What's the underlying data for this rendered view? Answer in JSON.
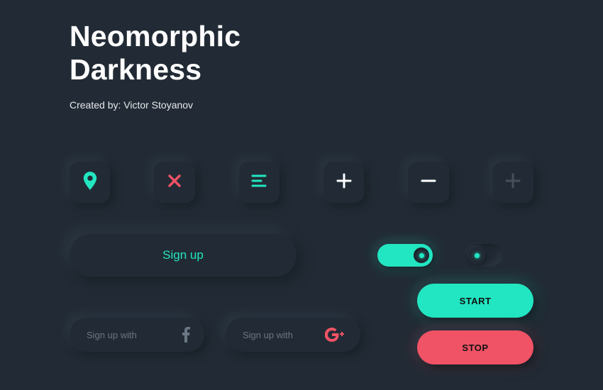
{
  "header": {
    "title_line1": "Neomorphic",
    "title_line2": "Darkness",
    "byline": "Created by: Victor Stoyanov"
  },
  "colors": {
    "accent": "#21e6c1",
    "danger": "#f05365",
    "bg": "#222b35",
    "muted": "#6a7683"
  },
  "icon_buttons": [
    {
      "name": "location-pin-icon"
    },
    {
      "name": "close-icon"
    },
    {
      "name": "menu-icon"
    },
    {
      "name": "plus-icon"
    },
    {
      "name": "minus-icon"
    },
    {
      "name": "plus-muted-icon"
    }
  ],
  "signup": {
    "label": "Sign up"
  },
  "toggles": {
    "on": true,
    "off": false
  },
  "social": [
    {
      "label": "Sign up with",
      "provider": "facebook"
    },
    {
      "label": "Sign up with",
      "provider": "google"
    }
  ],
  "actions": {
    "start": "START",
    "stop": "STOP"
  }
}
